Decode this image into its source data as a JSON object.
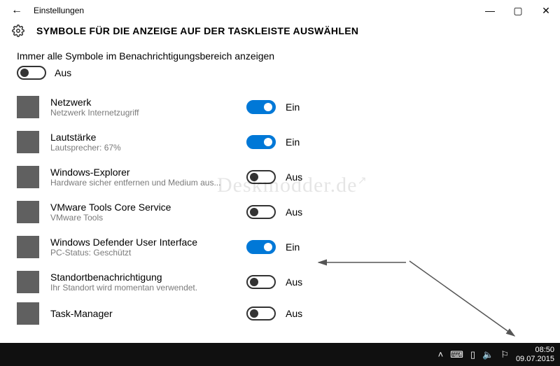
{
  "window": {
    "app_title": "Einstellungen",
    "minimize_glyph": "—",
    "maximize_glyph": "▢",
    "close_glyph": "✕",
    "back_glyph": "←"
  },
  "header": {
    "title": "SYMBOLE FÜR DIE ANZEIGE AUF DER TASKLEISTE AUSWÄHLEN"
  },
  "master": {
    "label": "Immer alle Symbole im Benachrichtigungsbereich anzeigen",
    "state_text": "Aus",
    "on": false
  },
  "state_labels": {
    "on": "Ein",
    "off": "Aus"
  },
  "items": [
    {
      "title": "Netzwerk",
      "subtitle": "Netzwerk Internetzugriff",
      "on": true,
      "icon": "network"
    },
    {
      "title": "Lautstärke",
      "subtitle": "Lautsprecher: 67%",
      "on": true,
      "icon": "volume"
    },
    {
      "title": "Windows-Explorer",
      "subtitle": "Hardware sicher entfernen und Medium aus...",
      "on": false,
      "icon": "usb"
    },
    {
      "title": "VMware Tools Core Service",
      "subtitle": "VMware Tools",
      "on": false,
      "icon": "vmware"
    },
    {
      "title": "Windows Defender User Interface",
      "subtitle": "PC-Status: Geschützt",
      "on": true,
      "icon": "defender"
    },
    {
      "title": "Standortbenachrichtigung",
      "subtitle": "Ihr Standort wird momentan verwendet.",
      "on": false,
      "icon": "location"
    },
    {
      "title": "Task-Manager",
      "subtitle": "",
      "on": false,
      "icon": "taskmgr"
    }
  ],
  "watermark": {
    "text": "Deskmodder.de",
    "ext_glyph": "↗"
  },
  "tray": {
    "chevron": "˄",
    "icons": [
      "⌨",
      "▯",
      "🔈",
      "⚐"
    ],
    "time": "08:50",
    "date": "09.07.2015"
  }
}
